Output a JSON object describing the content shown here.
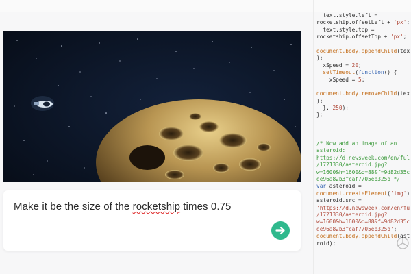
{
  "prompt": {
    "before": "Make it be the size of the ",
    "flagged_word": "rocketship",
    "after": " times 0.75"
  },
  "submit": {
    "icon": "arrow-right-icon",
    "color": "#2fb98d"
  },
  "canvas": {
    "background": "#0b1424",
    "objects": [
      "rocketship-image",
      "asteroid-image"
    ]
  },
  "code_lines": [
    [
      [
        "",
        "  text.style.left = "
      ]
    ],
    [
      [
        "",
        "rocketship.offsetLeft + "
      ],
      [
        "str",
        "'px'"
      ],
      [
        "",
        ";"
      ]
    ],
    [
      [
        "",
        "  text.style.top = "
      ]
    ],
    [
      [
        "",
        "rocketship.offsetTop + "
      ],
      [
        "str",
        "'px'"
      ],
      [
        "",
        ";"
      ]
    ],
    [
      [
        "",
        ""
      ]
    ],
    [
      [
        "fn",
        "document.body.appendChild"
      ],
      [
        "",
        "(text"
      ]
    ],
    [
      [
        "",
        ");"
      ]
    ],
    [
      [
        "",
        "  xSpeed = "
      ],
      [
        "num",
        "20"
      ],
      [
        "",
        ";"
      ]
    ],
    [
      [
        "",
        "  "
      ],
      [
        "fn",
        "setTimeout"
      ],
      [
        "",
        "("
      ],
      [
        "kw",
        "function"
      ],
      [
        "",
        "() {"
      ]
    ],
    [
      [
        "",
        "    xSpeed = "
      ],
      [
        "num",
        "5"
      ],
      [
        "",
        ";"
      ]
    ],
    [
      [
        "",
        ""
      ]
    ],
    [
      [
        "fn",
        "document.body.removeChild"
      ],
      [
        "",
        "(text"
      ]
    ],
    [
      [
        "",
        ");"
      ]
    ],
    [
      [
        "",
        "  }, "
      ],
      [
        "num",
        "250"
      ],
      [
        "",
        ");"
      ]
    ],
    [
      [
        "",
        "};"
      ]
    ],
    [
      [
        "",
        ""
      ]
    ],
    [
      [
        "",
        ""
      ]
    ],
    [
      [
        "",
        ""
      ]
    ],
    [
      [
        "comment",
        "/* Now add an image of an"
      ]
    ],
    [
      [
        "comment",
        "asteroid:"
      ]
    ],
    [
      [
        "comment",
        "https://d.newsweek.com/en/full"
      ]
    ],
    [
      [
        "comment",
        "/1721330/asteroid.jpg?"
      ]
    ],
    [
      [
        "comment",
        "w=1600&h=1600&q=88&f=9d82d35c9"
      ]
    ],
    [
      [
        "comment",
        "de96a82b3fcaf7705eb325b */"
      ]
    ],
    [
      [
        "kw",
        "var"
      ],
      [
        "",
        " asteroid ="
      ]
    ],
    [
      [
        "fn",
        "document.createElement"
      ],
      [
        "",
        "("
      ],
      [
        "str",
        "'img'"
      ],
      [
        "",
        ");"
      ]
    ],
    [
      [
        "",
        "asteroid.src ="
      ]
    ],
    [
      [
        "str",
        "'https://d.newsweek.com/en/full"
      ]
    ],
    [
      [
        "str",
        "/1721330/asteroid.jpg?"
      ]
    ],
    [
      [
        "str",
        "w=1600&h=1600&q=88&f=9d82d35c9"
      ]
    ],
    [
      [
        "str",
        "de96a82b3fcaf7705eb325b'"
      ],
      [
        "",
        ";"
      ]
    ],
    [
      [
        "fn",
        "document.body.appendChild"
      ],
      [
        "",
        "(aste"
      ]
    ],
    [
      [
        "",
        "roid);"
      ]
    ]
  ]
}
